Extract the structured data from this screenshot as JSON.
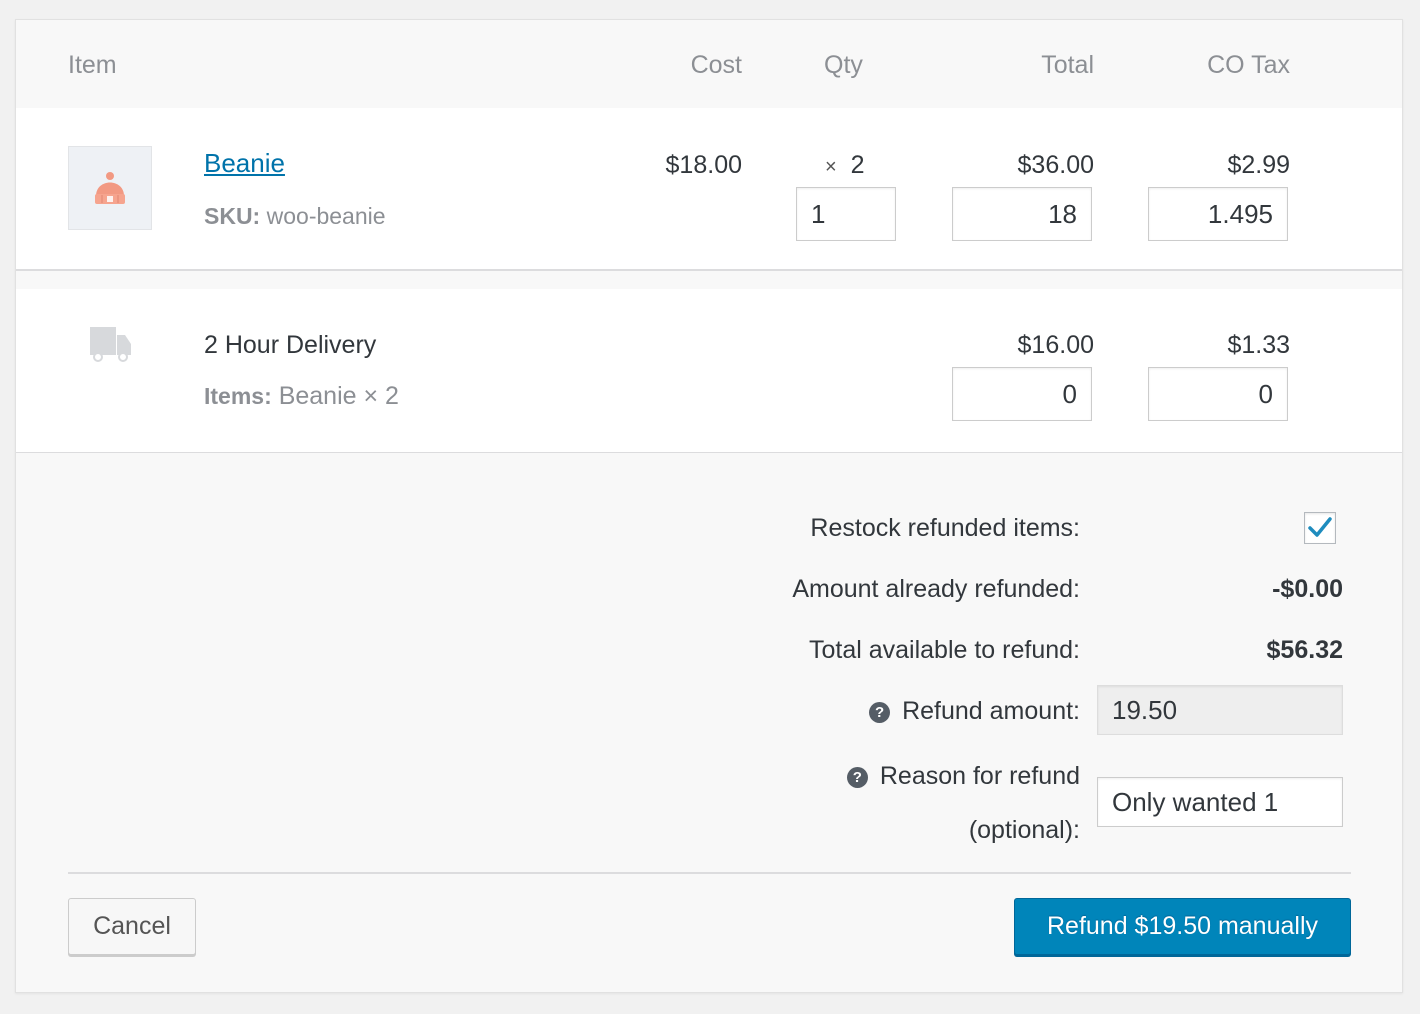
{
  "table": {
    "headers": {
      "item": "Item",
      "cost": "Cost",
      "qty": "Qty",
      "total": "Total",
      "tax": "CO Tax"
    }
  },
  "product": {
    "name": "Beanie",
    "sku_label": "SKU:",
    "sku": "woo-beanie",
    "cost": "$18.00",
    "qty_times": "×",
    "qty": "2",
    "total": "$36.00",
    "tax": "$2.99",
    "refund_qty": "1",
    "refund_total": "18",
    "refund_tax": "1.495",
    "icon": "beanie-hat-icon"
  },
  "shipping": {
    "name": "2 Hour Delivery",
    "items_label": "Items:",
    "items": "Beanie × 2",
    "total": "$16.00",
    "tax": "$1.33",
    "refund_total": "0",
    "refund_tax": "0",
    "icon": "truck-icon"
  },
  "refund": {
    "restock_label": "Restock refunded items:",
    "restock_checked": true,
    "already_label": "Amount already refunded:",
    "already_value": "-$0.00",
    "available_label": "Total available to refund:",
    "available_value": "$56.32",
    "amount_label": "Refund amount:",
    "amount_value": "19.50",
    "reason_label_1": "Reason for refund",
    "reason_label_2": "(optional):",
    "reason_value": "Only wanted 1",
    "help_glyph": "?"
  },
  "actions": {
    "cancel": "Cancel",
    "refund_manual": "Refund $19.50 manually"
  },
  "colors": {
    "accent": "#0085ba",
    "link": "#0073aa",
    "check": "#1e8cbe",
    "thumb_hat": "#f29982"
  }
}
